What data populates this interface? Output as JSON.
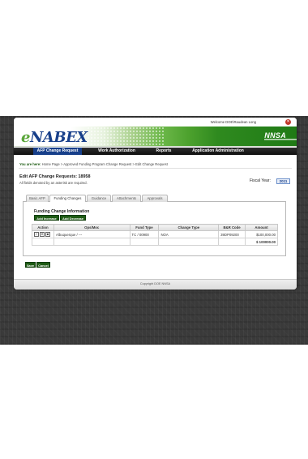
{
  "header": {
    "welcome_text": "Welcome DOE\\Raudean Long",
    "close_icon": "close-icon"
  },
  "banner": {
    "app_logo_first_letter": "e",
    "app_logo_rest": "NABEX",
    "org_logo": "NNSA"
  },
  "nav": {
    "items": [
      {
        "label": "AFP Change Request",
        "active": true
      },
      {
        "label": "Work Authorization",
        "active": false
      },
      {
        "label": "Reports",
        "active": false
      },
      {
        "label": "Application Administration",
        "active": false
      }
    ]
  },
  "breadcrumb": {
    "label": "You are here:",
    "path": "Home Page > Approved Funding Program Change Request > Edit Change Request"
  },
  "page": {
    "title": "Edit AFP Change Requests: 18958",
    "required_note": "All fields denoted by an asterisk are required.",
    "fiscal_year_label": "Fiscal Year:",
    "fiscal_year_value": "2011"
  },
  "tabs": [
    {
      "label": "Basic AFP",
      "active": false
    },
    {
      "label": "Funding Changes",
      "active": true
    },
    {
      "label": "Guidance",
      "active": false
    },
    {
      "label": "Attachments",
      "active": false
    },
    {
      "label": "Approvals",
      "active": false
    }
  ],
  "funding": {
    "section_title": "Funding Change Information",
    "add_increase_label": "Add Increase",
    "add_decrease_label": "Add Decrease",
    "columns": [
      "Action",
      "Ops/Moc",
      "Fund Type",
      "Change Type",
      "B&R Code",
      "Amount"
    ],
    "rows": [
      {
        "ops_moc": "Albuquerque / ---",
        "fund_type": "TC / 00900",
        "change_type": "NOA",
        "br_code": "39DP09200",
        "amount": "$100,000.00"
      }
    ],
    "action_icons": [
      "check-icon",
      "delete-icon",
      "detail-icon"
    ],
    "total": "$ 100000.00"
  },
  "actions": {
    "save_label": "Save",
    "cancel_label": "Cancel"
  },
  "footer": {
    "copyright": "Copyright DOE NNSA"
  }
}
